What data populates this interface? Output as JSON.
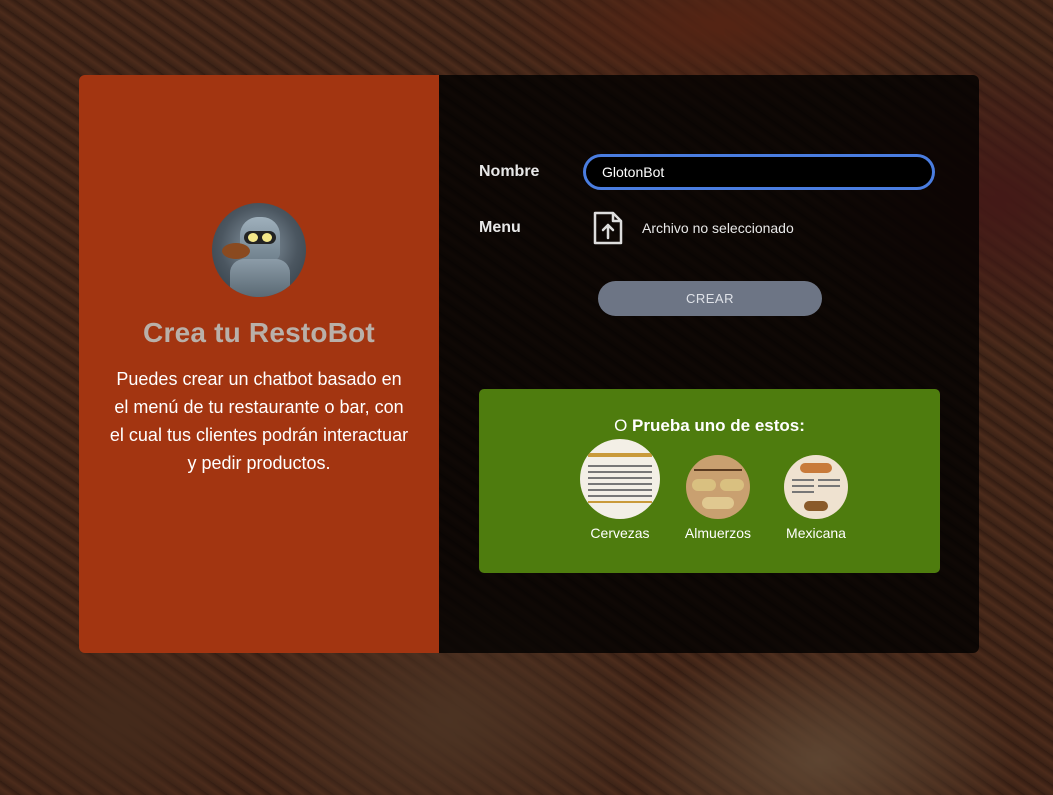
{
  "sidebar": {
    "title": "Crea tu RestoBot",
    "description": "Puedes crear un chatbot basado en el menú de tu restaurante o bar, con el cual tus clientes podrán interactuar y pedir productos."
  },
  "form": {
    "name_label": "Nombre",
    "name_value": "GlotonBot",
    "menu_label": "Menu",
    "file_status": "Archivo no seleccionado",
    "submit_label": "CREAR"
  },
  "try": {
    "prefix": "O",
    "title": "Prueba uno de estos:",
    "samples": [
      {
        "label": "Cervezas"
      },
      {
        "label": "Almuerzos"
      },
      {
        "label": "Mexicana"
      }
    ]
  },
  "colors": {
    "sidebar_bg": "#a33511",
    "try_bg": "#4e7c0e",
    "input_border": "#4a7de0",
    "button_bg": "#6d7585"
  }
}
